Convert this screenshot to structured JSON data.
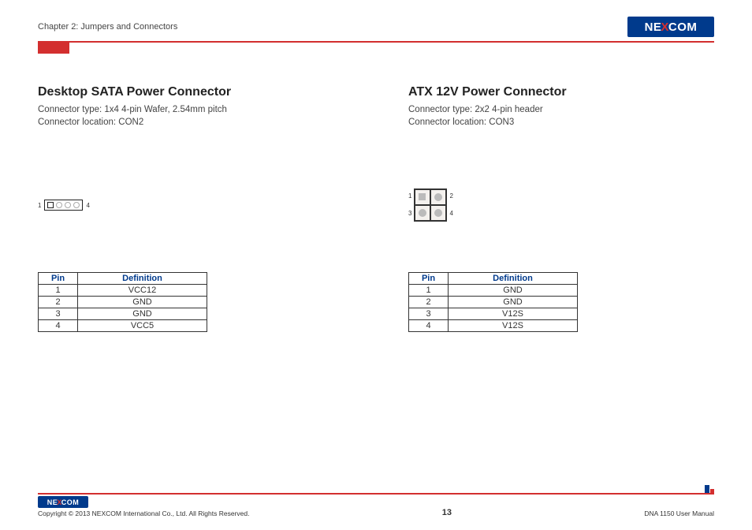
{
  "header": {
    "chapter": "Chapter 2: Jumpers and Connectors",
    "brand": "NEXCOM"
  },
  "left": {
    "title": "Desktop SATA Power Connector",
    "type_line": "Connector type: 1x4 4-pin Wafer, 2.54mm pitch",
    "loc_line": "Connector location: CON2",
    "diag_start": "1",
    "diag_end": "4",
    "table": {
      "head_pin": "Pin",
      "head_def": "Definition",
      "rows": [
        {
          "pin": "1",
          "def": "VCC12"
        },
        {
          "pin": "2",
          "def": "GND"
        },
        {
          "pin": "3",
          "def": "GND"
        },
        {
          "pin": "4",
          "def": "VCC5"
        }
      ]
    }
  },
  "right": {
    "title": "ATX 12V Power Connector",
    "type_line": "Connector type: 2x2 4-pin header",
    "loc_line": "Connector location: CON3",
    "diag_n1": "1",
    "diag_n2": "2",
    "diag_n3": "3",
    "diag_n4": "4",
    "table": {
      "head_pin": "Pin",
      "head_def": "Definition",
      "rows": [
        {
          "pin": "1",
          "def": "GND"
        },
        {
          "pin": "2",
          "def": "GND"
        },
        {
          "pin": "3",
          "def": "V12S"
        },
        {
          "pin": "4",
          "def": "V12S"
        }
      ]
    }
  },
  "footer": {
    "brand": "NEXCOM",
    "copyright": "Copyright © 2013 NEXCOM International Co., Ltd. All Rights Reserved.",
    "page": "13",
    "manual": "DNA 1150 User Manual"
  }
}
